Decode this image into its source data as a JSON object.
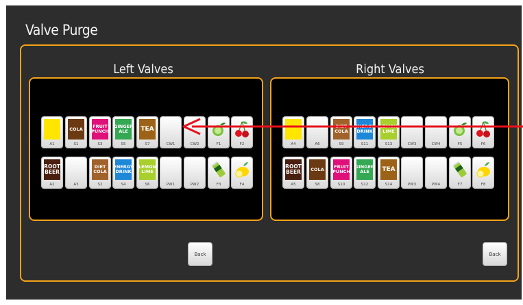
{
  "screen": {
    "title": "Valve Purge",
    "back_label": "Back"
  },
  "left_panel": {
    "title": "Left Valves",
    "row1": [
      {
        "label": "",
        "code": "A1",
        "color": "#ffe600",
        "kind": "swatch"
      },
      {
        "label": "COLA",
        "code": "S1",
        "color": "#6b3a12",
        "kind": "swatch"
      },
      {
        "label": "FRUIT PUNCH",
        "code": "S3",
        "color": "#e0107a",
        "kind": "swatch"
      },
      {
        "label": "GINGER ALE",
        "code": "S5",
        "color": "#34a853",
        "kind": "swatch"
      },
      {
        "label": "TEA",
        "code": "S7",
        "color": "#9c6318",
        "kind": "swatch"
      },
      {
        "label": "",
        "code": "CW1",
        "color": "",
        "kind": "blank"
      },
      {
        "label": "",
        "code": "CW2",
        "color": "",
        "kind": "blank"
      },
      {
        "label": "",
        "code": "F1",
        "color": "",
        "kind": "lime"
      },
      {
        "label": "",
        "code": "F2",
        "color": "",
        "kind": "cherry"
      }
    ],
    "row2": [
      {
        "label": "ROOT BEER",
        "code": "A2",
        "color": "#4a1f10",
        "kind": "swatch"
      },
      {
        "label": "",
        "code": "A3",
        "color": "",
        "kind": "blank"
      },
      {
        "label": "DIET COLA",
        "code": "S2",
        "color": "#a0622a",
        "kind": "swatch"
      },
      {
        "label": "ENERGY DRINK",
        "code": "S4",
        "color": "#1e88d8",
        "kind": "swatch"
      },
      {
        "label": "LEMON LIME",
        "code": "S6",
        "color": "#a8cf2c",
        "kind": "swatch"
      },
      {
        "label": "",
        "code": "PW1",
        "color": "",
        "kind": "blank"
      },
      {
        "label": "",
        "code": "PW2",
        "color": "",
        "kind": "blank"
      },
      {
        "label": "",
        "code": "F3",
        "color": "",
        "kind": "can"
      },
      {
        "label": "",
        "code": "F4",
        "color": "",
        "kind": "lemon"
      }
    ]
  },
  "right_panel": {
    "title": "Right Valves",
    "row1": [
      {
        "label": "",
        "code": "A4",
        "color": "#ffe600",
        "kind": "swatch"
      },
      {
        "label": "",
        "code": "A6",
        "color": "",
        "kind": "blank"
      },
      {
        "label": "DIET COLA",
        "code": "S9",
        "color": "#a0622a",
        "kind": "swatch"
      },
      {
        "label": "ENERGY DRINK",
        "code": "S11",
        "color": "#1e88d8",
        "kind": "swatch"
      },
      {
        "label": "LEMON LIME",
        "code": "S13",
        "color": "#a8cf2c",
        "kind": "swatch"
      },
      {
        "label": "",
        "code": "CW3",
        "color": "",
        "kind": "blank"
      },
      {
        "label": "",
        "code": "CW4",
        "color": "",
        "kind": "blank"
      },
      {
        "label": "",
        "code": "F5",
        "color": "",
        "kind": "lime"
      },
      {
        "label": "",
        "code": "F6",
        "color": "",
        "kind": "cherry"
      }
    ],
    "row2": [
      {
        "label": "ROOT BEER",
        "code": "A5",
        "color": "#4a1f10",
        "kind": "swatch"
      },
      {
        "label": "COLA",
        "code": "S8",
        "color": "#6b3a12",
        "kind": "swatch"
      },
      {
        "label": "FRUIT PUNCH",
        "code": "S10",
        "color": "#e0107a",
        "kind": "swatch"
      },
      {
        "label": "GINGER ALE",
        "code": "S12",
        "color": "#34a853",
        "kind": "swatch"
      },
      {
        "label": "TEA",
        "code": "S14",
        "color": "#9c6318",
        "kind": "swatch"
      },
      {
        "label": "",
        "code": "PW3",
        "color": "",
        "kind": "blank"
      },
      {
        "label": "",
        "code": "PW4",
        "color": "",
        "kind": "blank"
      },
      {
        "label": "",
        "code": "F7",
        "color": "",
        "kind": "can"
      },
      {
        "label": "",
        "code": "F8",
        "color": "",
        "kind": "lemon"
      }
    ]
  },
  "colors": {
    "accent": "#f5a31a",
    "panel_bg": "#000000",
    "screen_bg": "#2d2d2d",
    "arrow": "#e8111b"
  }
}
